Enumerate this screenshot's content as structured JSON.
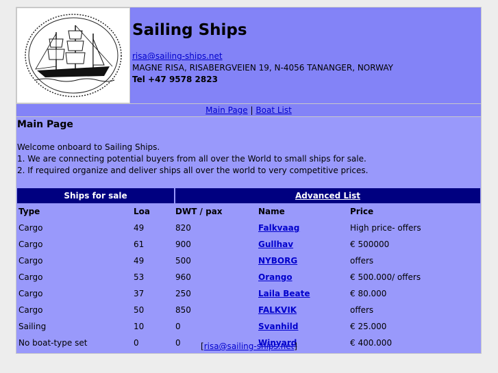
{
  "header": {
    "title": "Sailing Ships",
    "email": "risa@sailing-ships.net",
    "address": "MAGNE RISA, RISABERGVEIEN 19, N-4056 TANANGER, NORWAY",
    "phone": "Tel +47 9578 2823"
  },
  "nav": {
    "main_page": "Main Page",
    "separator": "|",
    "boat_list": "Boat List"
  },
  "main": {
    "heading": "Main Page",
    "welcome": "Welcome onboard to Sailing Ships.",
    "line1": "1. We are connecting potential buyers from all over the World to small ships for sale.",
    "line2": "2. If required organize and deliver ships all over the world to very competitive prices."
  },
  "table": {
    "ships_for_sale": "Ships for sale",
    "advanced_list": "Advanced List",
    "headers": [
      "Type",
      "Loa",
      "DWT / pax",
      "Name",
      "Price"
    ],
    "rows": [
      [
        "Cargo",
        "49",
        "820",
        "Falkvaag",
        "High price- offers"
      ],
      [
        "Cargo",
        "61",
        "900",
        "Gullhav",
        "€ 500000"
      ],
      [
        "Cargo",
        "49",
        "500",
        "NYBORG",
        "offers"
      ],
      [
        "Cargo",
        "53",
        "960",
        "Orango",
        "€ 500.000/ offers"
      ],
      [
        "Cargo",
        "37",
        "250",
        "Laila Beate",
        "€ 80.000"
      ],
      [
        "Cargo",
        "50",
        "850",
        "FALKVIK",
        "offers"
      ],
      [
        "Sailing",
        "10",
        "0",
        "Svanhild",
        "€ 25.000"
      ],
      [
        "No boat-type set",
        "0",
        "0",
        "Winyard",
        "€ 400.000"
      ]
    ]
  },
  "footer": {
    "open": "[",
    "email": "risa@sailing-ships.net",
    "close": "]"
  },
  "colors": {
    "header_bg": "#7f7ff5",
    "main_bg": "#9999fb",
    "banner_bg": "#000080",
    "link": "#0000cc"
  }
}
